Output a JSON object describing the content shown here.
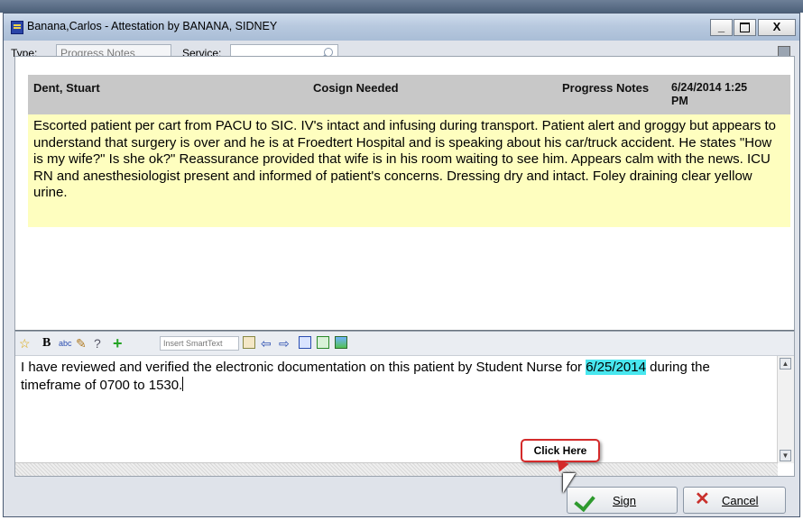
{
  "window": {
    "title": "Banana,Carlos - Attestation by BANANA, SIDNEY",
    "min_label": "_",
    "close_label": "X"
  },
  "toolbar": {
    "type_label": "Type:",
    "type_value": "Progress Notes",
    "service_label": "Service:",
    "service_value": ""
  },
  "note": {
    "author": "Dent, Stuart",
    "status": "Cosign Needed",
    "note_type": "Progress Notes",
    "datetime": "6/24/2014  1:25 PM",
    "body": "Escorted patient per cart from PACU to SIC. IV's intact and infusing during transport. Patient alert and groggy but appears to understand that surgery is over and he is at Froedtert Hospital and is speaking about his car/truck accident. He states \"How is my wife?\" Is she ok?\" Reassurance provided that wife is in his room waiting to see him. Appears calm with the news. ICU RN and anesthesiologist present and informed of patient's concerns. Dressing dry and intact. Foley draining clear yellow urine."
  },
  "editor": {
    "smarttext_placeholder": "Insert SmartText",
    "text_before": "I have reviewed and verified the electronic documentation on this patient by Student Nurse for ",
    "highlight_date": "6/25/2014",
    "text_after": " during the timeframe of 0700 to 1530.",
    "icons": [
      "star-icon",
      "bold-icon",
      "spellcheck-icon",
      "edit-icon",
      "help-icon",
      "add-icon",
      "smarttext-list-icon",
      "arrow-left-icon",
      "arrow-right-icon",
      "insert-icon",
      "refresh-icon",
      "image-icon"
    ]
  },
  "callout": {
    "text": "Click Here",
    "color": "#d42a2a"
  },
  "buttons": {
    "sign": "Sign",
    "cancel": "Cancel"
  },
  "colors": {
    "note_body_bg": "#fefebf",
    "note_header_bg": "#c8c8c8",
    "highlight": "#48e7ef"
  }
}
